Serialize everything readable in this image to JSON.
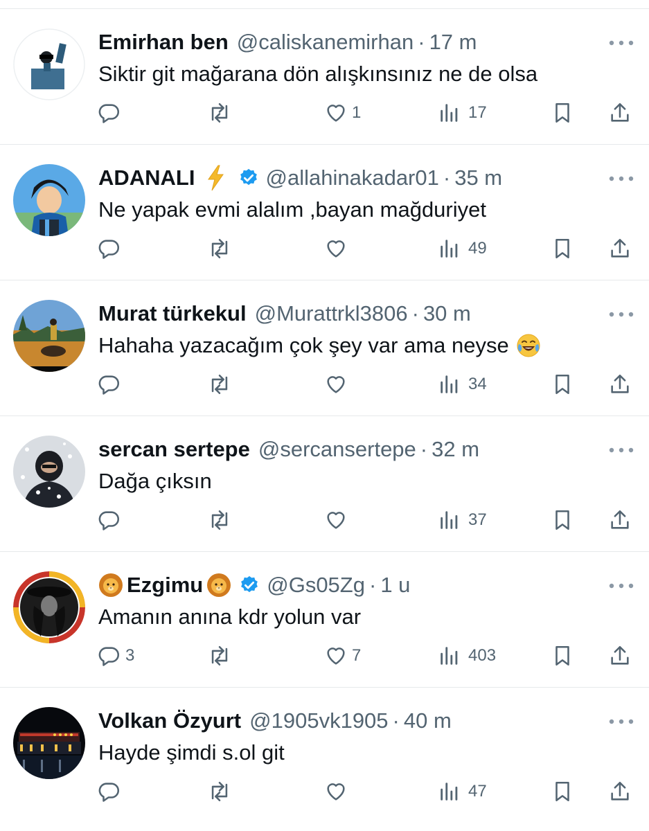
{
  "tweets": [
    {
      "name": "Emirhan ben",
      "handle": "@caliskanemirhan",
      "time": "17 m",
      "text": "Siktir git mağarana dön alışkınsınız ne de olsa",
      "replies": "",
      "retweets": "",
      "likes": "1",
      "views": "17"
    },
    {
      "name": "ADANALI",
      "name_emoji_after": "⚡",
      "verified": true,
      "handle": "@allahinakadar01",
      "time": "35 m",
      "text": "Ne yapak evmi alalım ,bayan mağduriyet",
      "replies": "",
      "retweets": "",
      "likes": "",
      "views": "49"
    },
    {
      "name": "Murat türkekul",
      "handle": "@Murattrkl3806",
      "time": "30 m",
      "text": "Hahaha yazacağım çok şey var ama neyse",
      "text_emoji": "😂",
      "replies": "",
      "retweets": "",
      "likes": "",
      "views": "34"
    },
    {
      "name": "sercan sertepe",
      "handle": "@sercansertepe",
      "time": "32 m",
      "text": "Dağa çıksın",
      "replies": "",
      "retweets": "",
      "likes": "",
      "views": "37"
    },
    {
      "name": "Ezgimu",
      "name_emoji_before": "🦁",
      "name_emoji_after": "🦁",
      "verified": true,
      "handle": "@Gs05Zg",
      "time": "1 u",
      "text": "Amanın anına kdr yolun var",
      "replies": "3",
      "retweets": "",
      "likes": "7",
      "views": "403"
    },
    {
      "name": "Volkan Özyurt",
      "handle": "@1905vk1905",
      "time": "40 m",
      "text": "Hayde şimdi s.ol git",
      "replies": "",
      "retweets": "",
      "likes": "",
      "views": "47"
    }
  ],
  "separator": "·",
  "icons": {
    "more": "more-horizontal-icon",
    "reply": "reply-icon",
    "retweet": "retweet-icon",
    "like": "heart-icon",
    "views": "views-chart-icon",
    "bookmark": "bookmark-icon",
    "share": "share-icon",
    "verified": "verified-badge-icon"
  },
  "colors": {
    "text": "#0f1419",
    "secondary": "#536471",
    "verified": "#1d9bf0",
    "divider": "#e6e9eb"
  }
}
